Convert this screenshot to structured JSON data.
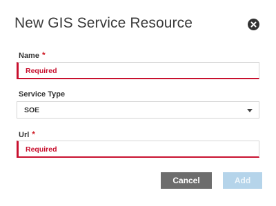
{
  "dialog": {
    "title": "New GIS Service Resource",
    "close_icon": "close-circle-icon"
  },
  "fields": {
    "name": {
      "label": "Name",
      "required_mark": "*",
      "value": "Required"
    },
    "service_type": {
      "label": "Service Type",
      "value": "SOE",
      "caret_icon": "chevron-down-icon"
    },
    "url": {
      "label": "Url",
      "required_mark": "*",
      "value": "Required"
    }
  },
  "buttons": {
    "cancel_label": "Cancel",
    "add_label": "Add"
  },
  "colors": {
    "error": "#c8102e",
    "cancel_bg": "#6d6d6d",
    "add_bg_disabled": "#b5d4ea"
  }
}
